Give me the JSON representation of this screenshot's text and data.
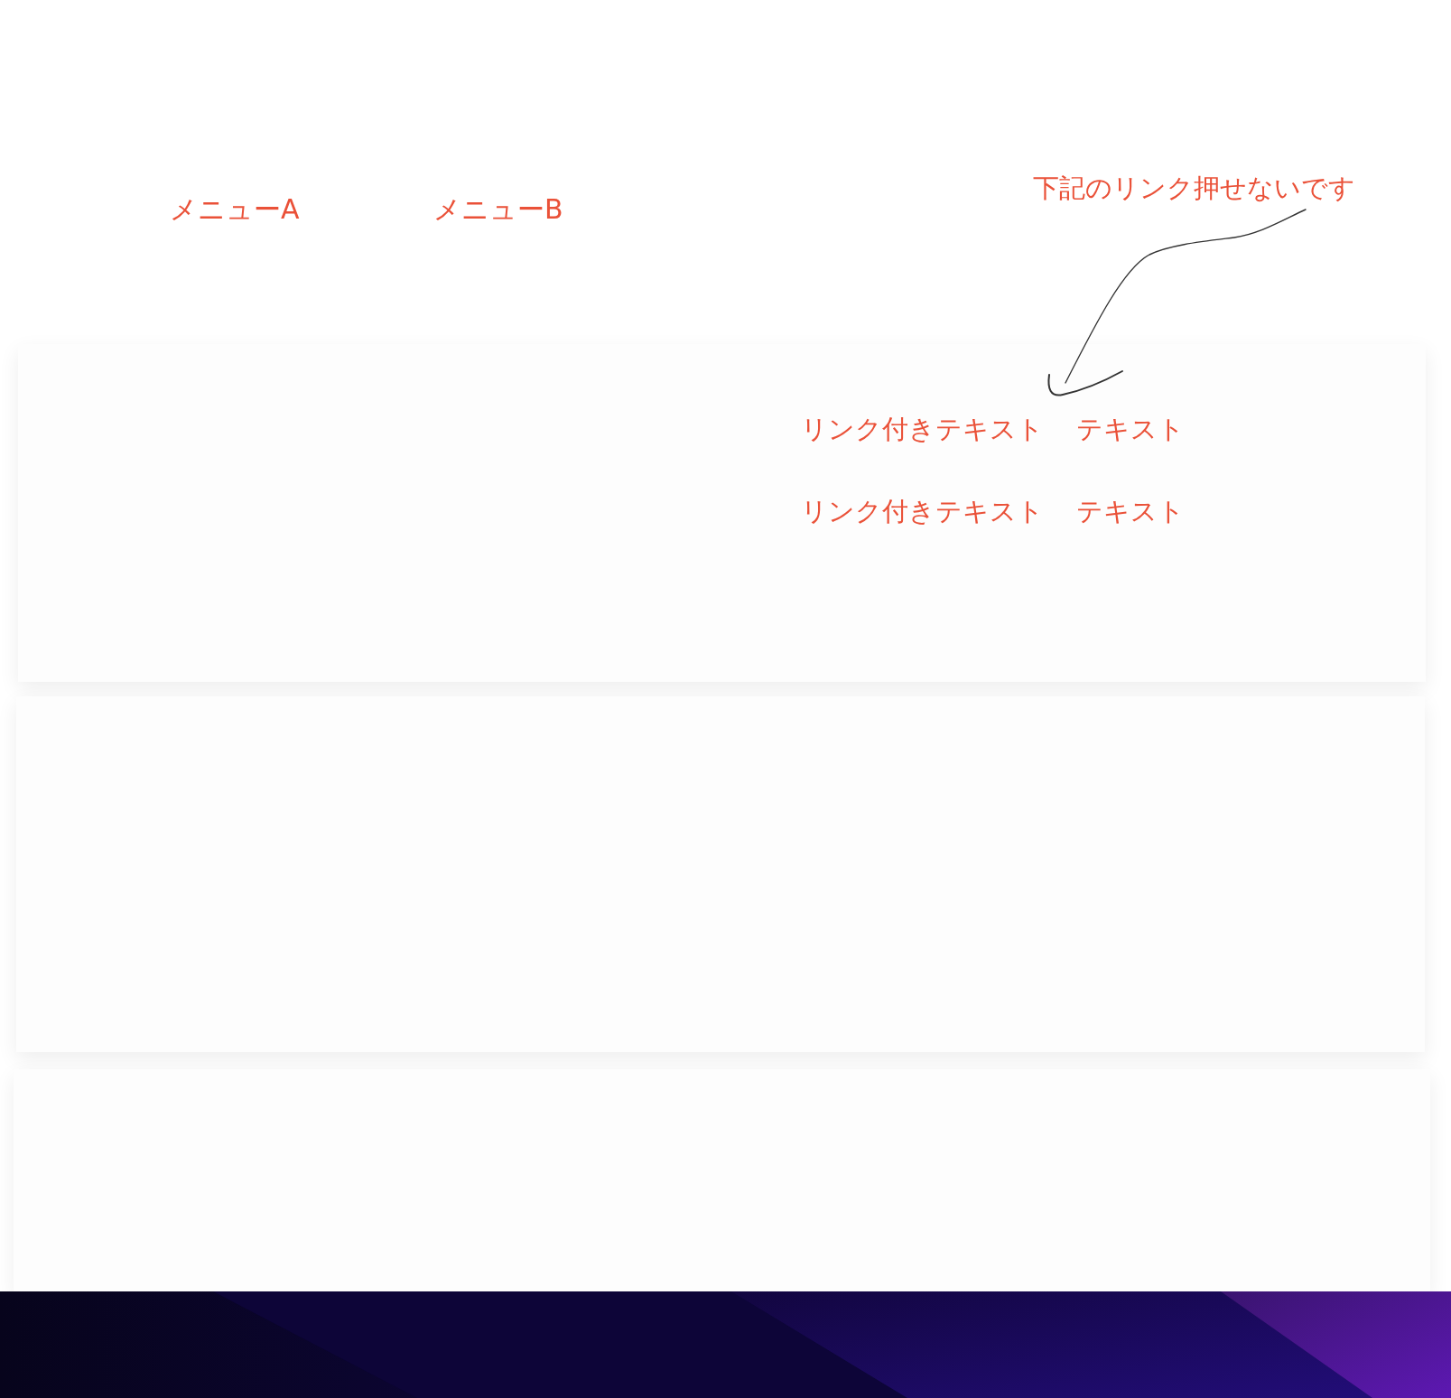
{
  "nav": {
    "items": [
      {
        "label": "メニューA"
      },
      {
        "label": "メニューB"
      }
    ]
  },
  "annotation": {
    "text": "下記のリンク押せないです"
  },
  "cards": [
    {
      "kind": "links",
      "rows": [
        {
          "link": "リンク付きテキスト",
          "text": "テキスト"
        },
        {
          "link": "リンク付きテキスト",
          "text": "テキスト"
        }
      ]
    },
    {
      "kind": "blank"
    },
    {
      "kind": "blank"
    }
  ]
}
